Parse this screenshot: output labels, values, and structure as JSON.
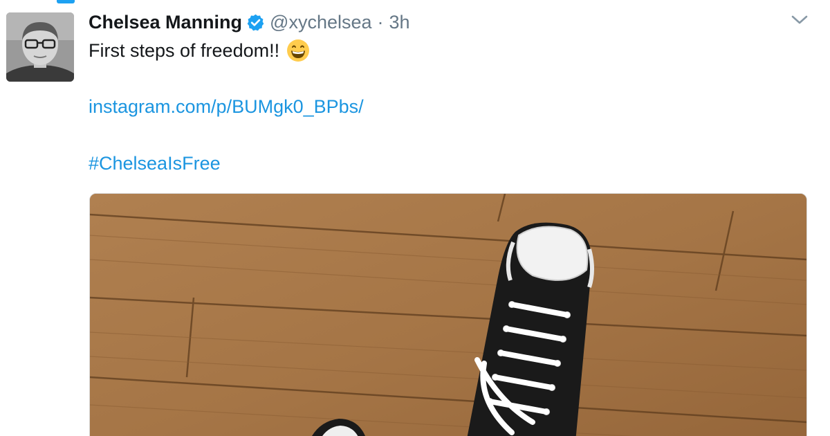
{
  "tweet": {
    "author_name": "Chelsea Manning",
    "handle": "@xychelsea",
    "separator": "·",
    "timestamp": "3h",
    "text_line1": "First steps of freedom!!",
    "emoji": "grinning-face-emoji",
    "link": "instagram.com/p/BUMgk0_BPbs/",
    "hashtag": "#ChelseaIsFree"
  },
  "icons": {
    "verified": "verified-badge-icon",
    "menu": "chevron-down-icon"
  },
  "colors": {
    "link_blue": "#1b95e0",
    "verified_blue": "#1da1f2",
    "text_dark": "#14171a",
    "text_muted": "#657786"
  }
}
